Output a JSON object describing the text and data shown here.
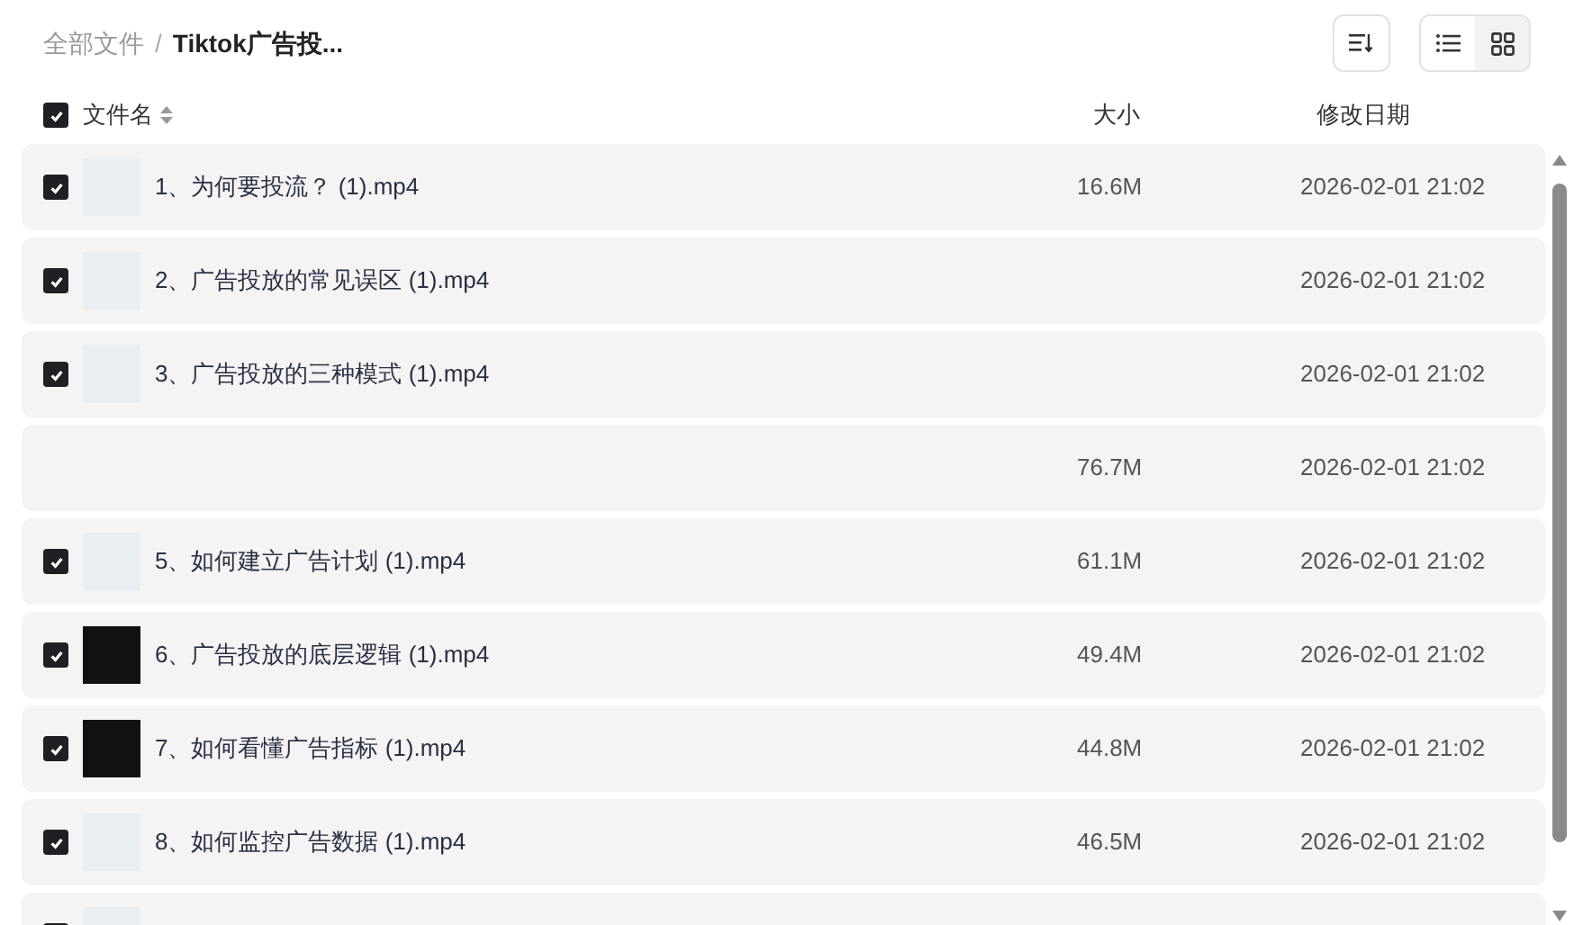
{
  "breadcrumb": [
    {
      "label": "全部文件",
      "current": false
    },
    {
      "label": "Tiktok广告投...",
      "current": true
    }
  ],
  "breadcrumb_separator": "/",
  "views": [
    {
      "kind": "list",
      "selected": false
    },
    {
      "kind": "grid",
      "selected": true
    }
  ],
  "header": {
    "checked": true,
    "name": "文件名",
    "size": "大小",
    "date": "修改日期"
  },
  "rows": [
    {
      "checked": true,
      "kind": "light",
      "name": "1、为何要投流？ (1).mp4",
      "size": "16.6M",
      "date": "2026-02-01 21:02"
    },
    {
      "checked": true,
      "kind": "light",
      "name": "2、广告投放的常见误区 (1).mp4",
      "date": "2026-02-01 21:02"
    },
    {
      "checked": true,
      "kind": "light",
      "name": "3、广告投放的三种模式 (1).mp4",
      "date": "2026-02-01 21:02"
    },
    {
      "size": "76.7M",
      "date": "2026-02-01 21:02"
    },
    {
      "checked": true,
      "kind": "light",
      "name": "5、如何建立广告计划 (1).mp4",
      "size": "61.1M",
      "date": "2026-02-01 21:02"
    },
    {
      "checked": true,
      "kind": "dark",
      "name": "6、广告投放的底层逻辑 (1).mp4",
      "size": "49.4M",
      "date": "2026-02-01 21:02"
    },
    {
      "checked": true,
      "kind": "dark",
      "name": "7、如何看懂广告指标 (1).mp4",
      "size": "44.8M",
      "date": "2026-02-01 21:02"
    },
    {
      "checked": true,
      "kind": "light",
      "name": "8、如何监控广告数据 (1).mp4",
      "size": "46.5M",
      "date": "2026-02-01 21:02"
    },
    {
      "checked": true,
      "kind": "light"
    }
  ]
}
